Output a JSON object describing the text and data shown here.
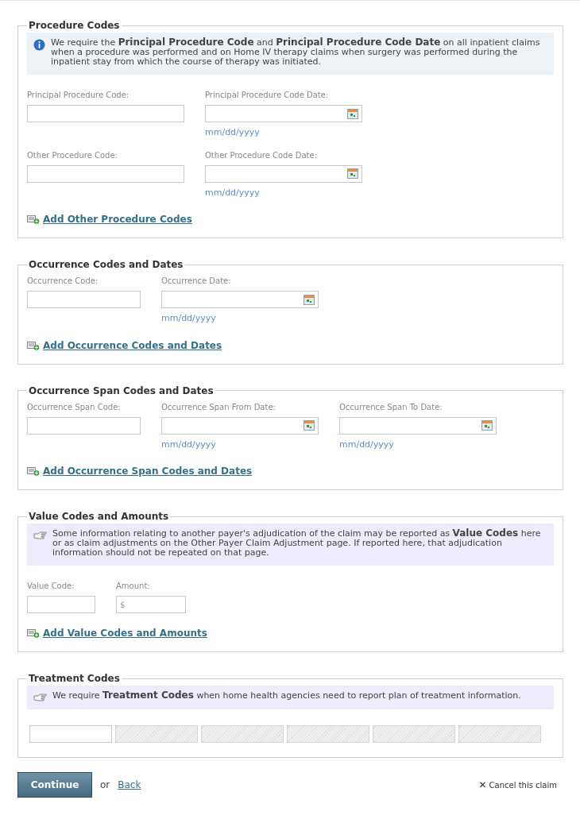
{
  "sections": [
    {
      "title": "Procedure Codes",
      "note": {
        "kind": "info",
        "text": "We require the **Principal Procedure Code** and **Principal Procedure Code Date** on all inpatient claims when a procedure was performed and on Home IV therapy claims when surgery was performed during the inpatient stay from which the course of therapy was initiated."
      },
      "rows": [
        [
          {
            "kind": "text",
            "label": "Principal Procedure Code:"
          },
          {
            "kind": "date",
            "label": "Principal Procedure Code Date:",
            "hint": "mm/dd/yyyy"
          }
        ],
        [
          {
            "kind": "text",
            "label": "Other Procedure Code:"
          },
          {
            "kind": "date",
            "label": "Other Procedure Code Date:",
            "hint": "mm/dd/yyyy"
          }
        ]
      ],
      "add_link": "Add Other Procedure Codes"
    },
    {
      "title": "Occurrence Codes and Dates",
      "rows": [
        [
          {
            "kind": "text",
            "label": "Occurrence Code:"
          },
          {
            "kind": "date",
            "label": "Occurrence Date:",
            "hint": "mm/dd/yyyy"
          }
        ]
      ],
      "add_link": "Add Occurrence Codes and Dates"
    },
    {
      "title": "Occurrence Span Codes and Dates",
      "rows": [
        [
          {
            "kind": "text",
            "label": "Occurrence Span Code:"
          },
          {
            "kind": "date",
            "label": "Occurrence Span From Date:",
            "hint": "mm/dd/yyyy"
          },
          {
            "kind": "date",
            "label": "Occurrence Span To Date:",
            "hint": "mm/dd/yyyy"
          }
        ]
      ],
      "add_link": "Add Occurrence Span Codes and Dates"
    },
    {
      "title": "Value Codes and Amounts",
      "note": {
        "kind": "tip",
        "text": "Some information relating to another payer's adjudication of the claim may be reported as **Value Codes** here or as claim adjustments on the Other Payer Claim Adjustment page. If reported here, that adjudication information should not be repeated on that page."
      },
      "rows": [
        [
          {
            "kind": "text",
            "label": "Value Code:"
          },
          {
            "kind": "amount",
            "label": "Amount:",
            "placeholder": "$"
          }
        ]
      ],
      "add_link": "Add Value Codes and Amounts"
    },
    {
      "title": "Treatment Codes",
      "note": {
        "kind": "tip",
        "text": "We require **Treatment Codes** when home health agencies need to report plan of treatment information."
      },
      "boxes": [
        {
          "disabled": false
        },
        {
          "disabled": true
        },
        {
          "disabled": true
        },
        {
          "disabled": true
        },
        {
          "disabled": true
        },
        {
          "disabled": true
        }
      ]
    }
  ],
  "footer": {
    "continue": "Continue",
    "or": "or",
    "back": "Back",
    "cancel_icon": "✕",
    "cancel": "Cancel this claim"
  }
}
